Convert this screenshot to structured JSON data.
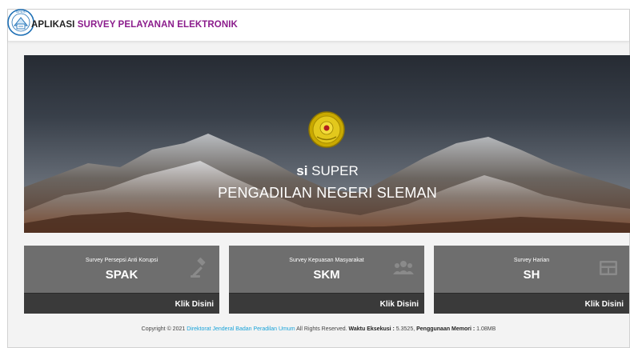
{
  "header": {
    "logo_text": "SIPERI",
    "title_prefix": "APLIKASI",
    "title_highlight": "SURVEY PELAYANAN ELEKTRONIK"
  },
  "hero": {
    "title_bold": "si",
    "title_rest": " SUPER",
    "subtitle": "PENGADILAN NEGERI SLEMAN"
  },
  "cards": [
    {
      "label": "Survey Persepsi Anti Korupsi",
      "name": "SPAK",
      "link": "Klik Disini",
      "icon": "gavel-icon"
    },
    {
      "label": "Survey Kepuasan Masyarakat",
      "name": "SKM",
      "link": "Klik Disini",
      "icon": "users-icon"
    },
    {
      "label": "Survey Harian",
      "name": "SH",
      "link": "Klik Disini",
      "icon": "grid-icon"
    }
  ],
  "footer": {
    "copyright": "Copyright © 2021 ",
    "org_link": "Direktorat Jenderal Badan Peradilan Umum",
    "rights": " All Rights Reserved. ",
    "exec_label": "Waktu Eksekusi :",
    "exec_value": " 5.3525, ",
    "mem_label": "Penggunaan Memori :",
    "mem_value": " 1.08MB"
  },
  "colors": {
    "title_highlight": "#8b1c8c",
    "card_bg": "#6e6e6e",
    "card_footer": "#3a3a3a",
    "footer_link": "#1aa3d9"
  }
}
